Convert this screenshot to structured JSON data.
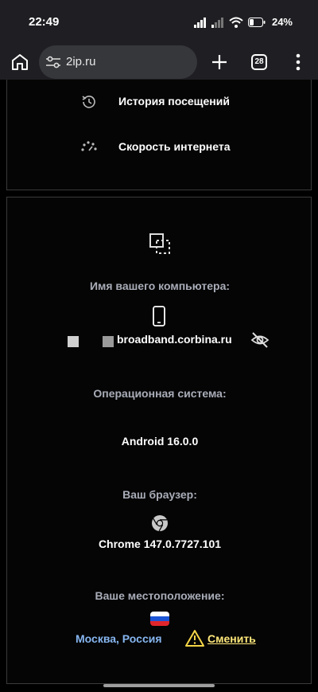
{
  "status_bar": {
    "time": "22:49",
    "battery": "24%"
  },
  "browser": {
    "url": "2ip.ru",
    "tab_count": "28"
  },
  "menu": {
    "items": [
      {
        "label": "История посещений",
        "icon": "history-icon"
      },
      {
        "label": "Скорость интернета",
        "icon": "speedometer-icon"
      }
    ]
  },
  "info": {
    "computer_name_label": "Имя вашего компьютера:",
    "computer_name_value": "broadband.corbina.ru",
    "os_label": "Операционная система:",
    "os_value": "Android 16.0.0",
    "browser_label": "Ваш браузер:",
    "browser_value": "Chrome 147.0.7727.101",
    "location_label": "Ваше местоположение:",
    "location_value": "Москва, Россия",
    "change_link": "Сменить"
  },
  "colors": {
    "background": "#000000",
    "toolbar": "#1f1f23",
    "url_bar": "#36373b",
    "label_grey": "#a9adb8",
    "location_blue": "#86b6f0",
    "link_yellow": "#ffe87a",
    "warning_yellow": "#f5d547"
  }
}
